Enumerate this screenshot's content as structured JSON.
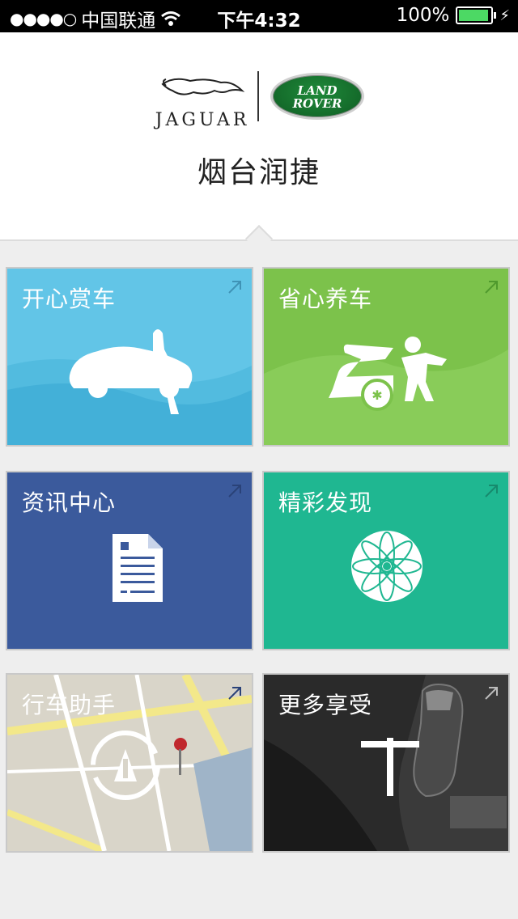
{
  "status_bar": {
    "carrier": "中国联通",
    "time": "下午4:32",
    "battery": "100%"
  },
  "header": {
    "brand_left": "JAGUAR",
    "brand_right_line1": "LAND",
    "brand_right_line2": "ROVER",
    "title": "烟台润捷"
  },
  "tiles": [
    {
      "label": "开心赏车",
      "icon": "car-with-figure-icon",
      "color": "#62c5e7"
    },
    {
      "label": "省心养车",
      "icon": "car-mechanic-icon",
      "color": "#7cc24b"
    },
    {
      "label": "资讯中心",
      "icon": "document-icon",
      "color": "#3b5a9c"
    },
    {
      "label": "精彩发现",
      "icon": "flower-icon",
      "color": "#1fb791"
    },
    {
      "label": "行车助手",
      "icon": "road-assistant-icon",
      "color": "#d7d3c6"
    },
    {
      "label": "更多享受",
      "icon": "plus-icon",
      "color": "#2d2d2d"
    }
  ]
}
